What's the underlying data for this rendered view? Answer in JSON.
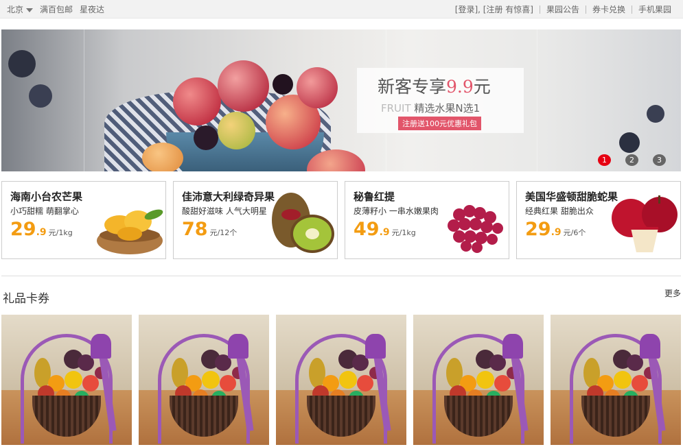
{
  "topbar": {
    "city": "北京",
    "links_left": [
      "满百包邮",
      "星夜达"
    ],
    "login_label": "[登录]",
    "register_label": ", [注册 有惊喜]",
    "links_right": [
      "果园公告",
      "券卡兑换",
      "手机果园"
    ]
  },
  "banner": {
    "headline_prefix": "新客专享",
    "headline_price": "9.9",
    "headline_suffix": "元",
    "sub_en": "FRUIT",
    "sub_cn": " 精选水果N选1",
    "tag": "注册送100元优惠礼包",
    "dots": [
      "1",
      "2",
      "3"
    ],
    "active_dot": 0,
    "accent_color": "#e2556a"
  },
  "products": [
    {
      "title": "海南小台农芒果",
      "sub": "小巧甜糯 萌翻掌心",
      "price_int": "29",
      "price_dec": ".9",
      "unit": "元/1kg",
      "icon": "mango-basket-image"
    },
    {
      "title": "佳沛意大利绿奇异果",
      "sub": "酸甜好滋味 人气大明星",
      "price_int": "78",
      "price_dec": "",
      "unit": "元/12个",
      "icon": "kiwi-image"
    },
    {
      "title": "秘鲁红提",
      "sub": "皮薄籽小 一串水嫩果肉",
      "price_int": "49",
      "price_dec": ".9",
      "unit": "元/1kg",
      "icon": "red-grapes-image"
    },
    {
      "title": "美国华盛顿甜脆蛇果",
      "sub": "经典红果 甜脆出众",
      "price_int": "29",
      "price_dec": ".9",
      "unit": "元/6个",
      "icon": "red-apple-image"
    }
  ],
  "section": {
    "title": "礼品卡券",
    "more": "更多"
  },
  "gifts": [
    {
      "icon": "fruit-gift-basket-image"
    },
    {
      "icon": "fruit-gift-basket-image"
    },
    {
      "icon": "fruit-gift-basket-image"
    },
    {
      "icon": "fruit-gift-basket-image"
    },
    {
      "icon": "fruit-gift-basket-image"
    }
  ],
  "colors": {
    "price": "#f39c12",
    "dot_active": "#e60012"
  }
}
